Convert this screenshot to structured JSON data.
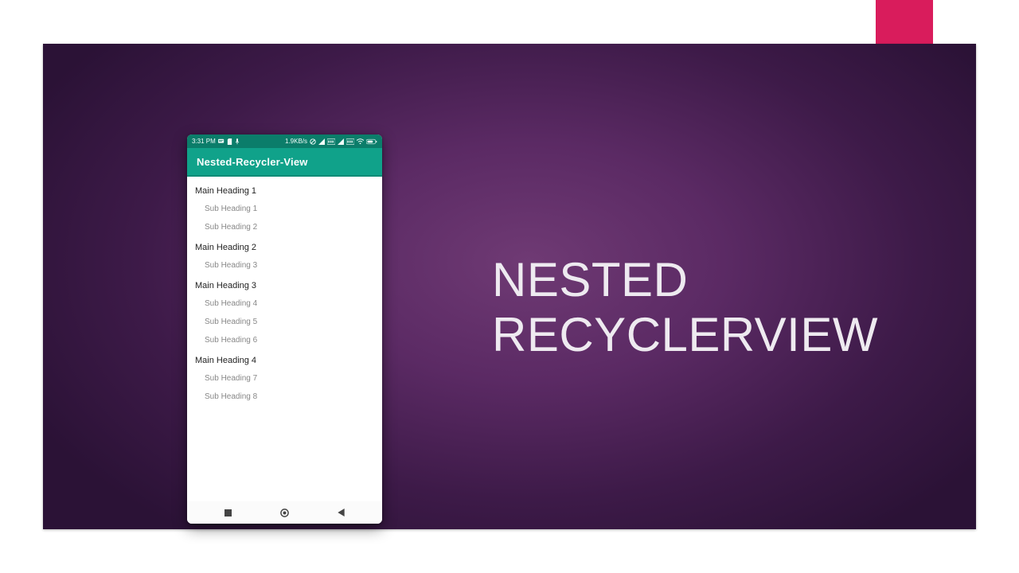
{
  "slide": {
    "title_line1": "NESTED",
    "title_line2": "RECYCLERVIEW",
    "accent_color": "#d91c5c"
  },
  "phone": {
    "status": {
      "time": "3:31 PM",
      "net_speed": "1.9KB/s"
    },
    "app_title": "Nested-Recycler-View",
    "groups": [
      {
        "title": "Main Heading 1",
        "subs": [
          "Sub Heading 1",
          "Sub Heading 2"
        ]
      },
      {
        "title": "Main Heading 2",
        "subs": [
          "Sub Heading 3"
        ]
      },
      {
        "title": "Main Heading 3",
        "subs": [
          "Sub Heading 4",
          "Sub Heading 5",
          "Sub Heading 6"
        ]
      },
      {
        "title": "Main Heading 4",
        "subs": [
          "Sub Heading 7",
          "Sub Heading 8"
        ]
      }
    ]
  }
}
